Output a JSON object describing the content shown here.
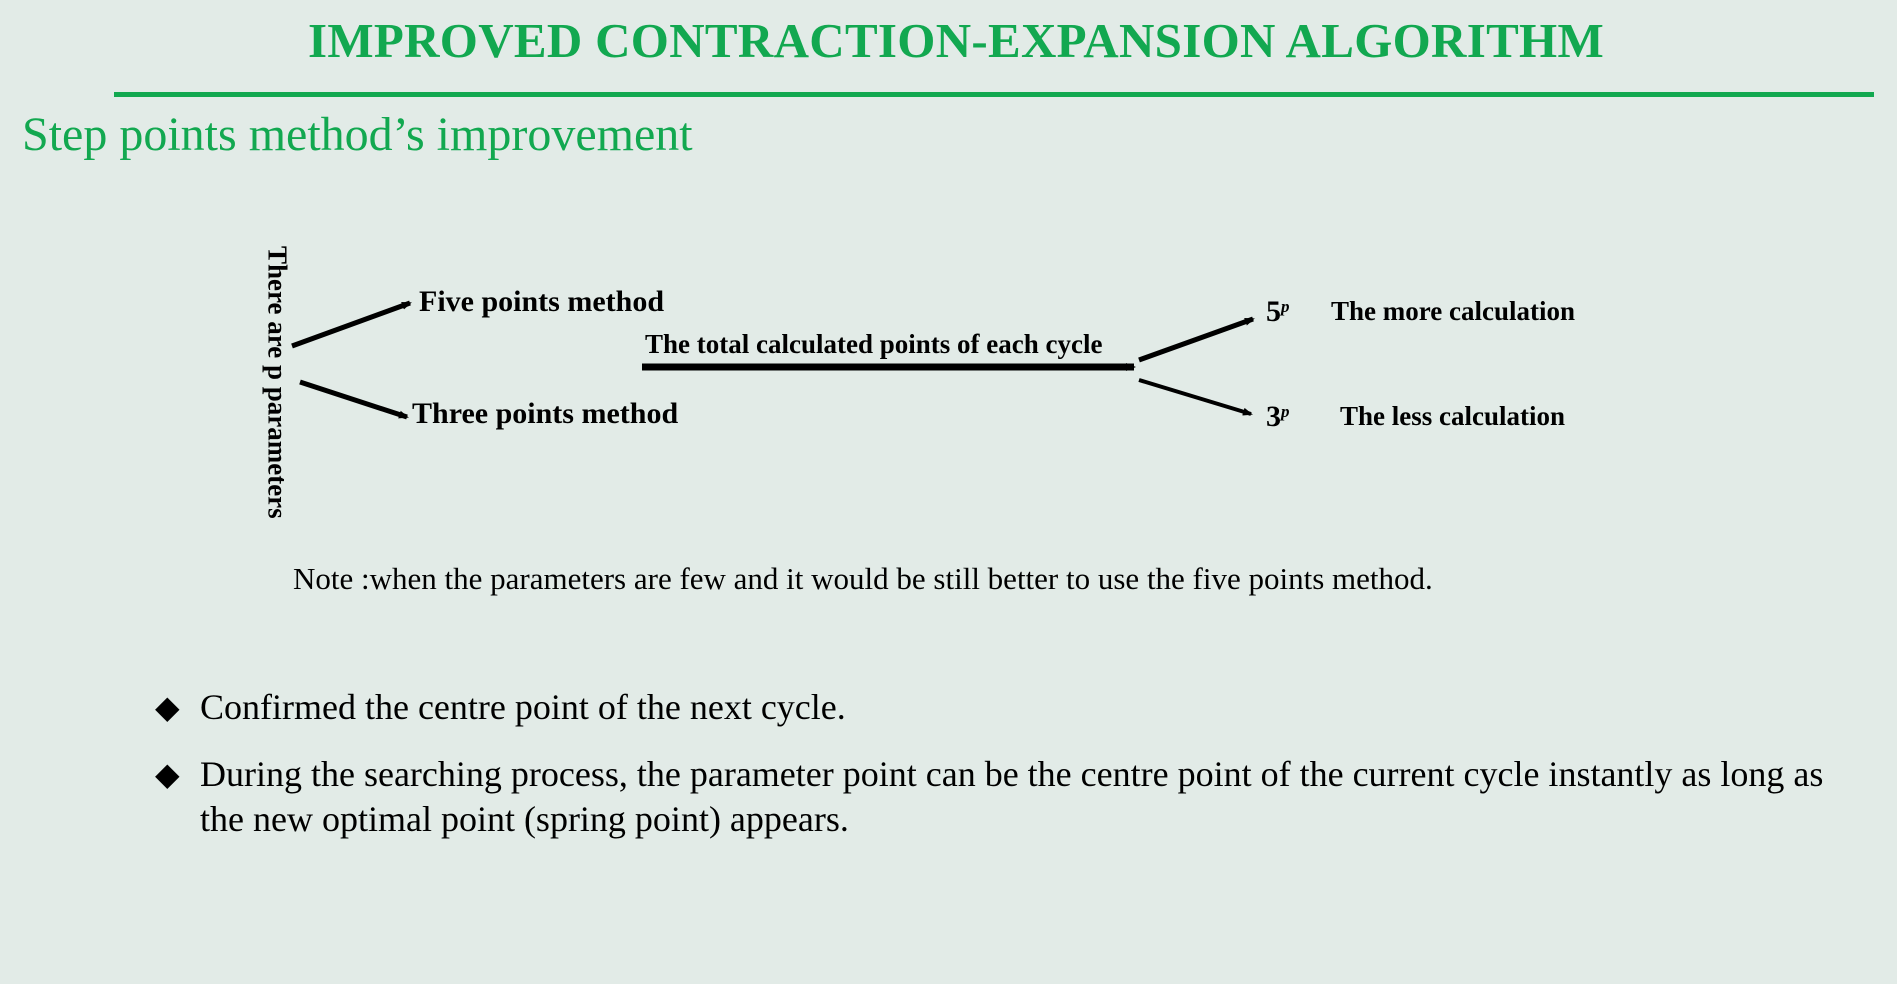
{
  "slide": {
    "title": "IMPROVED CONTRACTION-EXPANSION ALGORITHM",
    "subtitle": "Step points method’s improvement"
  },
  "diagram": {
    "source_label": "There are p parameters",
    "five_method": "Five points method",
    "three_method": "Three points method",
    "total_label": "The total calculated points of each cycle",
    "five_result": {
      "base": "5",
      "exponent": "p"
    },
    "three_result": {
      "base": "3",
      "exponent": "p"
    },
    "more_calc": "The more calculation",
    "less_calc": "The less calculation"
  },
  "note": "Note :when the parameters are few and it would be still better to use the five points method.",
  "bullets": [
    {
      "icon": "diamond-bullet-icon",
      "text": "Confirmed the centre point of the next cycle."
    },
    {
      "icon": "diamond-bullet-icon",
      "text": "During the searching process, the parameter point can be the centre point of the current cycle instantly as long as the new optimal point (spring point) appears."
    }
  ],
  "colors": {
    "background": "#e2ebe7",
    "accent": "#12a850",
    "text": "#000000"
  }
}
